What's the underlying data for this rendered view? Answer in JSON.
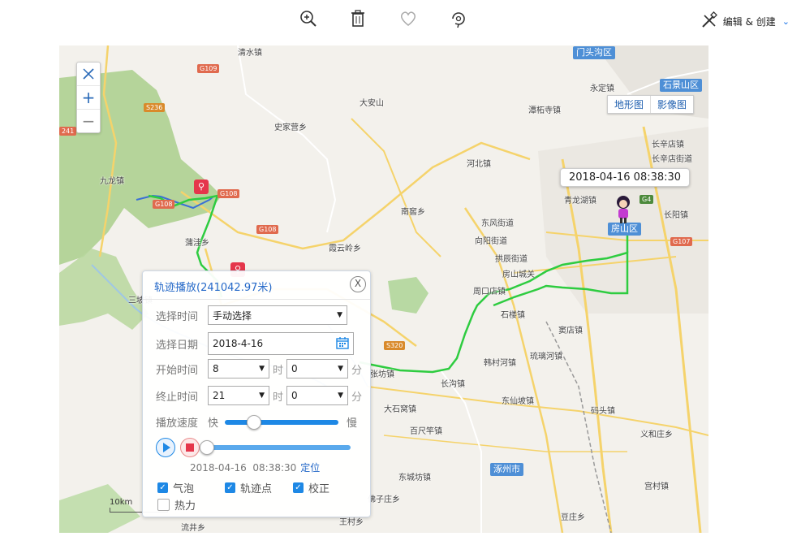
{
  "toolbar": {
    "icons": [
      "zoom-in-icon",
      "trash-icon",
      "heart-icon",
      "rotate-icon"
    ],
    "edit_create_label": "编辑 & 创建"
  },
  "map": {
    "zoom_in": "+",
    "zoom_out": "−",
    "map_types": [
      "地形图",
      "影像图"
    ],
    "bubble_text": "2018-04-16 08:38:30",
    "scale_label": "10km",
    "place_labels": [
      "清水镇",
      "大安山",
      "史家营乡",
      "九龙镇",
      "蒲洼乡",
      "霞云岭乡",
      "南窖乡",
      "河北镇",
      "潭柘寺镇",
      "永定镇",
      "长辛店镇",
      "长辛店街道",
      "青龙湖镇",
      "长阳镇",
      "东风街道",
      "向阳街道",
      "拱辰街道",
      "房山城关",
      "周口店镇",
      "石楼镇",
      "窦店镇",
      "韩村河镇",
      "琉璃河镇",
      "长沟镇",
      "东仙坡镇",
      "大石窝镇",
      "码头镇",
      "百尺竿镇",
      "义和庄乡",
      "东城坊镇",
      "宫村镇",
      "豆庄乡",
      "王村乡",
      "流井乡",
      "三坡镇",
      "张坊镇",
      "佛子庄乡"
    ],
    "district_labels": [
      "门头沟区",
      "石景山区",
      "房山区",
      "涿州市"
    ],
    "road_badges": [
      "G109",
      "S236",
      "G108",
      "G108",
      "G108",
      "G4",
      "G107",
      "S320",
      "241"
    ]
  },
  "panel": {
    "title": "轨迹播放(241042.97米)",
    "close": "X",
    "labels": {
      "select_time": "选择时间",
      "select_date": "选择日期",
      "start_time": "开始时间",
      "end_time": "终止时间",
      "speed": "播放速度"
    },
    "select_time_value": "手动选择",
    "date_value": "2018-4-16",
    "start_hour": "8",
    "start_min": "0",
    "end_hour": "21",
    "end_min": "0",
    "hour_unit": "时",
    "min_unit": "分",
    "speed_fast": "快",
    "speed_slow": "慢",
    "speed_level": 0.25,
    "progress": 0.0,
    "timestamp": "2018-04-16  08:38:30",
    "locate_link": "定位",
    "checkboxes": [
      {
        "label": "气泡",
        "checked": true
      },
      {
        "label": "轨迹点",
        "checked": true
      },
      {
        "label": "校正",
        "checked": true
      }
    ],
    "heat_label": "热力"
  },
  "colors": {
    "accent": "#1e88e5",
    "track": "#2ecc40",
    "title_blue": "#2468c8"
  }
}
